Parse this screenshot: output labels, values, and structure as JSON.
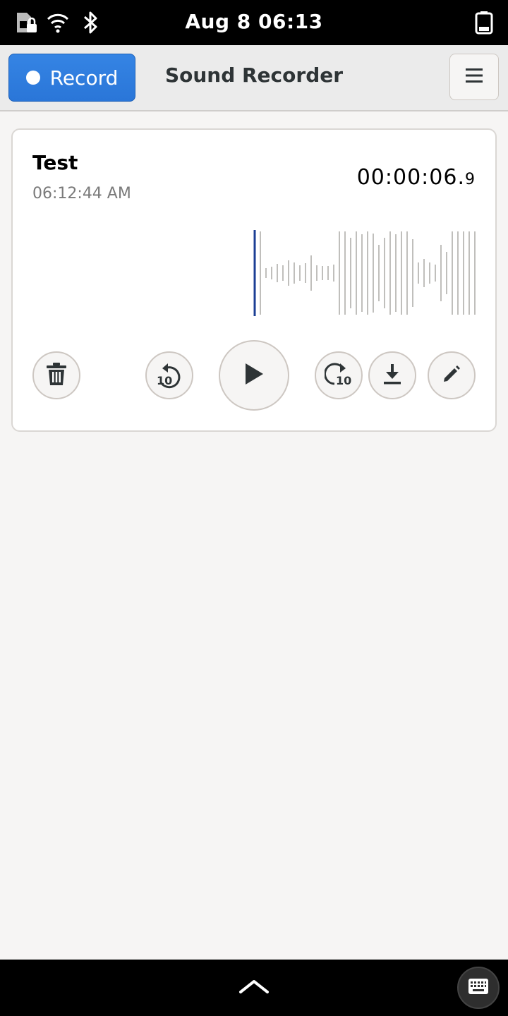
{
  "status_bar": {
    "clock": "Aug 8  06:13",
    "icons": [
      "sim-locked-icon",
      "wifi-icon",
      "bluetooth-icon",
      "battery-icon"
    ]
  },
  "header": {
    "record_label": "Record",
    "title": "Sound Recorder",
    "menu_icon": "hamburger-menu-icon"
  },
  "recording": {
    "name": "Test",
    "time": "06:12:44 AM",
    "duration_main": "00:00:06.",
    "duration_tenths": "9",
    "playhead_color": "#1c3f94"
  },
  "controls": {
    "delete_icon": "trash-icon",
    "seek_back_label": "10",
    "play_icon": "play-icon",
    "seek_forward_label": "10",
    "export_icon": "download-icon",
    "rename_icon": "pencil-icon"
  },
  "bottom_bar": {
    "expand_icon": "chevron-up-icon",
    "keyboard_icon": "keyboard-icon"
  },
  "colors": {
    "accent": "#3584e4",
    "background": "#f6f5f4"
  }
}
